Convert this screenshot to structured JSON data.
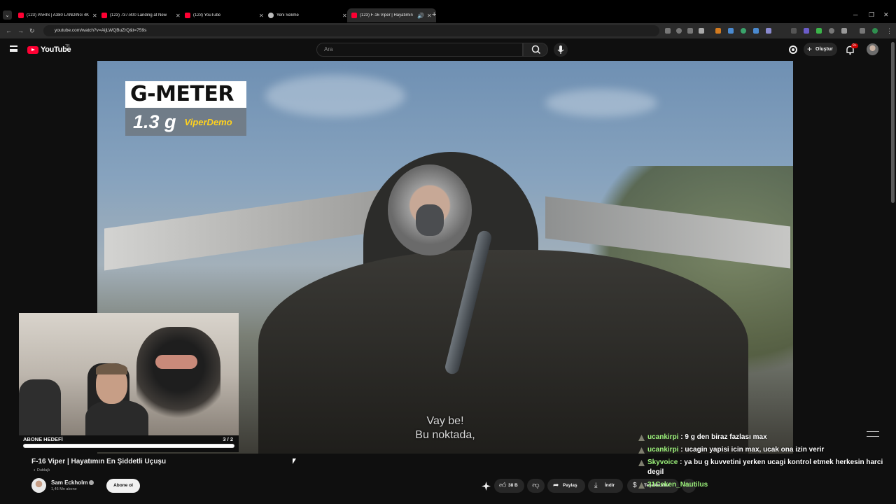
{
  "browser": {
    "tabs": [
      {
        "label": "(123) PARIS | A380 LANDING 4K"
      },
      {
        "label": "(123) 737-800 Landing at New"
      },
      {
        "label": "(123) YouTube"
      },
      {
        "label": "Yeni Sekme"
      },
      {
        "label": "(123) F-16 Viper | Hayatımın"
      }
    ],
    "new_tab": "+",
    "url": "youtube.com/watch?v=AijLWQBuZrQ&t=759s"
  },
  "youtube": {
    "logo": "YouTube",
    "region": "TR",
    "search_placeholder": "Ara",
    "create_label": "Oluştur",
    "notif_count": "9+"
  },
  "video": {
    "overlay_title": "G-METER",
    "overlay_value": "1.3 g",
    "overlay_brand": "ViperDemo",
    "subtitle_line1": "Vay be!",
    "subtitle_line2": "Bu noktada,"
  },
  "stream_goal": {
    "label": "ABONE HEDEFİ",
    "count": "3 / 2",
    "progress": 1.0
  },
  "meta": {
    "title": "F-16 Viper | Hayatımın En Şiddetli Uçuşu",
    "dubbed": "Dublajlı",
    "channel": "Sam Eckholm",
    "subs": "1,46 Mn abone",
    "subscribe": "Abone ol",
    "likes": "38 B",
    "share": "Paylaş",
    "download": "İndir",
    "thanks": "Teşekkürler",
    "more": "..."
  },
  "chat": [
    {
      "user": "ucankirpi",
      "message": ": 9 g den biraz fazlası max"
    },
    {
      "user": "ucankirpi",
      "message": ": ucagin yapisi icin max, ucak ona izin verir"
    },
    {
      "user": "Skyvoice",
      "message": ": ya bu g kuvvetini yerken ucagi kontrol etmek herkesin harci degil"
    },
    {
      "user": "31Ceken_Nautilus",
      "message": ""
    }
  ],
  "colors": {
    "accent_red": "#ff0033",
    "chat_user": "#9cf27b",
    "gmeter_brand": "#ffd21e"
  }
}
